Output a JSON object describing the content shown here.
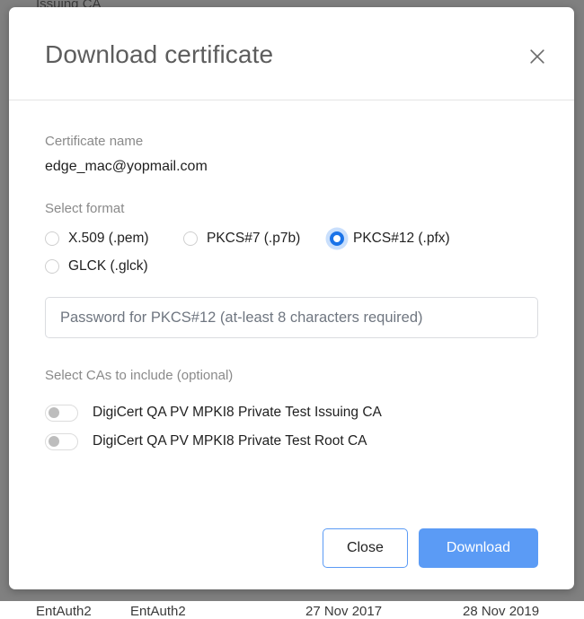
{
  "background": {
    "top_row_text": "Issuing CA",
    "bottom_row": [
      "EntAuth2",
      "EntAuth2",
      "27 Nov 2017",
      "28 Nov 2019"
    ]
  },
  "dialog": {
    "title": "Download certificate",
    "close_icon": "close-icon",
    "certificate_name": {
      "label": "Certificate name",
      "value": "edge_mac@yopmail.com"
    },
    "format": {
      "label": "Select format",
      "selected": "PKCS#12 (.pfx)",
      "options": [
        {
          "label": "X.509 (.pem)",
          "checked": false
        },
        {
          "label": "PKCS#7 (.p7b)",
          "checked": false
        },
        {
          "label": "PKCS#12 (.pfx)",
          "checked": true
        },
        {
          "label": "GLCK (.glck)",
          "checked": false
        }
      ]
    },
    "password": {
      "placeholder": "Password for PKCS#12 (at-least 8 characters required)",
      "value": ""
    },
    "cas": {
      "label": "Select CAs to include (optional)",
      "items": [
        {
          "name": "DigiCert QA PV MPKI8 Private Test Issuing CA",
          "enabled": false
        },
        {
          "name": "DigiCert QA PV MPKI8 Private Test Root CA",
          "enabled": false
        }
      ]
    },
    "footer": {
      "close_label": "Close",
      "download_label": "Download"
    }
  },
  "colors": {
    "accent_blue": "#5b9bf5",
    "radio_blue": "#1a73e8",
    "radio_halo": "#c9dffc",
    "title_gray": "#5d5d5d",
    "label_gray": "#8a8a8a",
    "backdrop": "#808080"
  }
}
